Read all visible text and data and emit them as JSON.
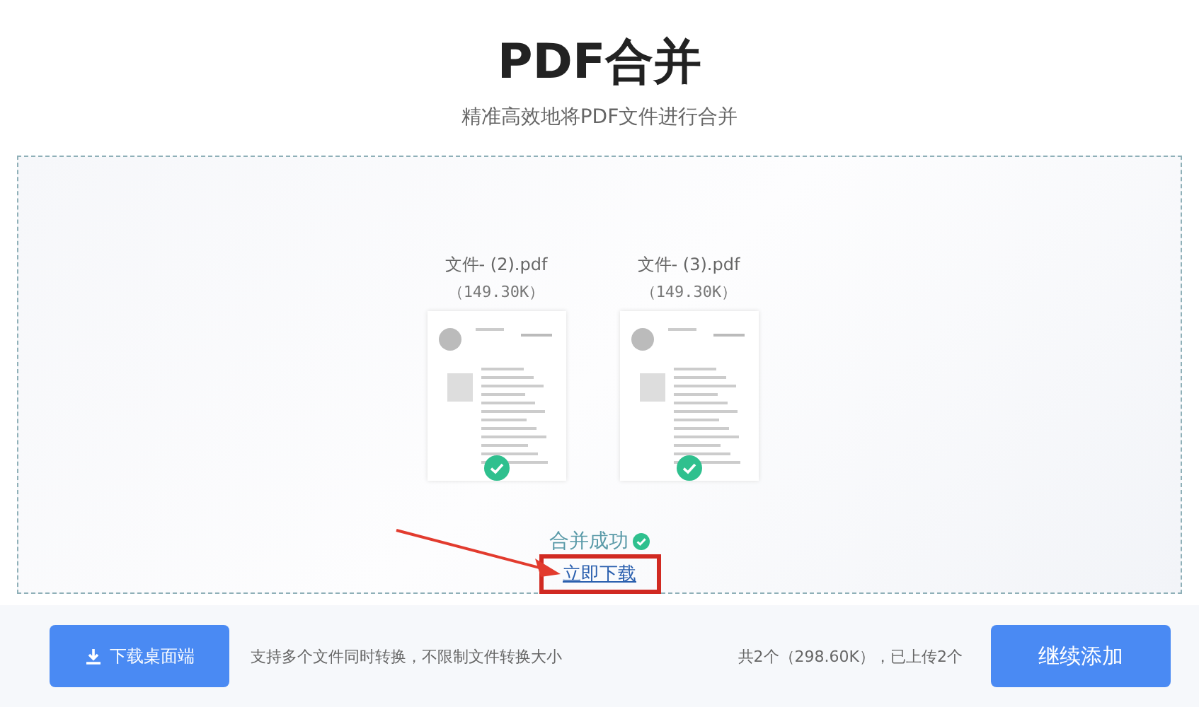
{
  "title": "PDF合并",
  "subtitle": "精准高效地将PDF文件进行合并",
  "files": [
    {
      "name": "文件- (2).pdf",
      "size": "（149.30K）",
      "done": true
    },
    {
      "name": "文件- (3).pdf",
      "size": "（149.30K）",
      "done": true
    }
  ],
  "result": {
    "status": "合并成功",
    "download_link": "立即下载",
    "highlighted": true
  },
  "footer": {
    "desktop_button": "下载桌面端",
    "note": "支持多个文件同时转换，不限制文件转换大小",
    "summary": "共2个（298.60K），已上传2个",
    "add_button": "继续添加"
  }
}
